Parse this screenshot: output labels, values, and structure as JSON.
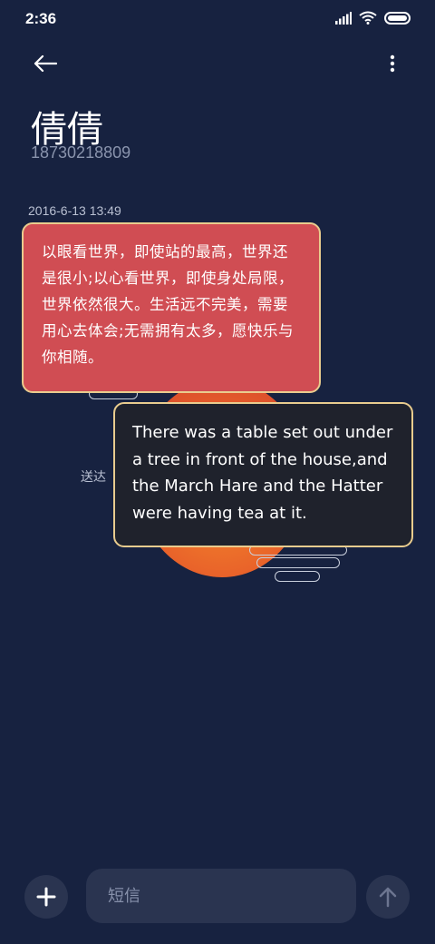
{
  "status_bar": {
    "time": "2:36"
  },
  "contact": {
    "name": "倩倩",
    "number": "18730218809"
  },
  "conversation": {
    "timestamp": "2016-6-13 13:49",
    "messages": [
      {
        "direction": "received",
        "text": "以眼看世界，即使站的最高，世界还是很小;以心看世界，即使身处局限，世界依然很大。生活远不完美，需要用心去体会;无需拥有太多，愿快乐与你相随。"
      },
      {
        "direction": "sent",
        "text": "There was a table set out under a tree in front of the house,and the March Hare and the Hatter were having tea at it."
      }
    ],
    "status": "送达"
  },
  "composer": {
    "placeholder": "短信"
  },
  "colors": {
    "background": "#172240",
    "received_bubble": "#d04d53",
    "sent_bubble": "#1f222c",
    "bubble_border": "#e9cc8e"
  }
}
